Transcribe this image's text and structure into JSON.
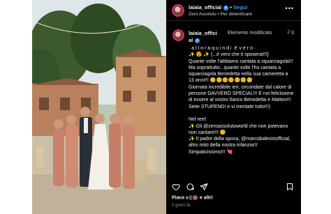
{
  "header": {
    "username": "laiaia_official",
    "follow_label": "Segui",
    "separator": "•",
    "song": "Zero Assoluto",
    "song_title": "Per dimenticare",
    "more_label": "•••"
  },
  "caption": {
    "username": "laiaia_offici al",
    "modified_label": "Elemento modificato",
    "time": "2 g",
    "text": "· a l l o r a q u i n d i  è' v e r o ·\n✨ 😍 ✨ {...è vero che ti sposerai!!!}\nQuante volte l'abbiamo cantata a squarciagola!!! Ma soprattutto...quante volte l'ho cantata a squarciagola Benedetta nella sua cameretta a 13 anni!!! 😊😊😊😊😊😊😊\nGiornata incredibile ieri, circondate dal calore di persone DAVVERO SPECIAL!!! E noi felicissime di essere al vostro fianco Benedetta e Matteo!!! Siete STUPENDI e vi meritate tutto!!!)\n\nNel reel:\n✨ Gli @zeroassolutoworld che non potevano non cantare!!! 😊\n✨ Il padre della sposa, @marcobalestriofficial, altro mito della nostra infanzia!!! Simpaticissimo!!! 💘"
  },
  "footer": {
    "likes_label": "Piace a",
    "likes_rest": "e altri",
    "date": "2 giorni fa"
  },
  "icons": {
    "like": "heart-icon",
    "comment": "comment-icon",
    "share": "send-icon",
    "save": "bookmark-icon"
  },
  "colors": {
    "panel_bg": "#000000",
    "link_blue": "#3797f0",
    "verified_blue": "#3797f0",
    "ring": "#c72e77"
  }
}
